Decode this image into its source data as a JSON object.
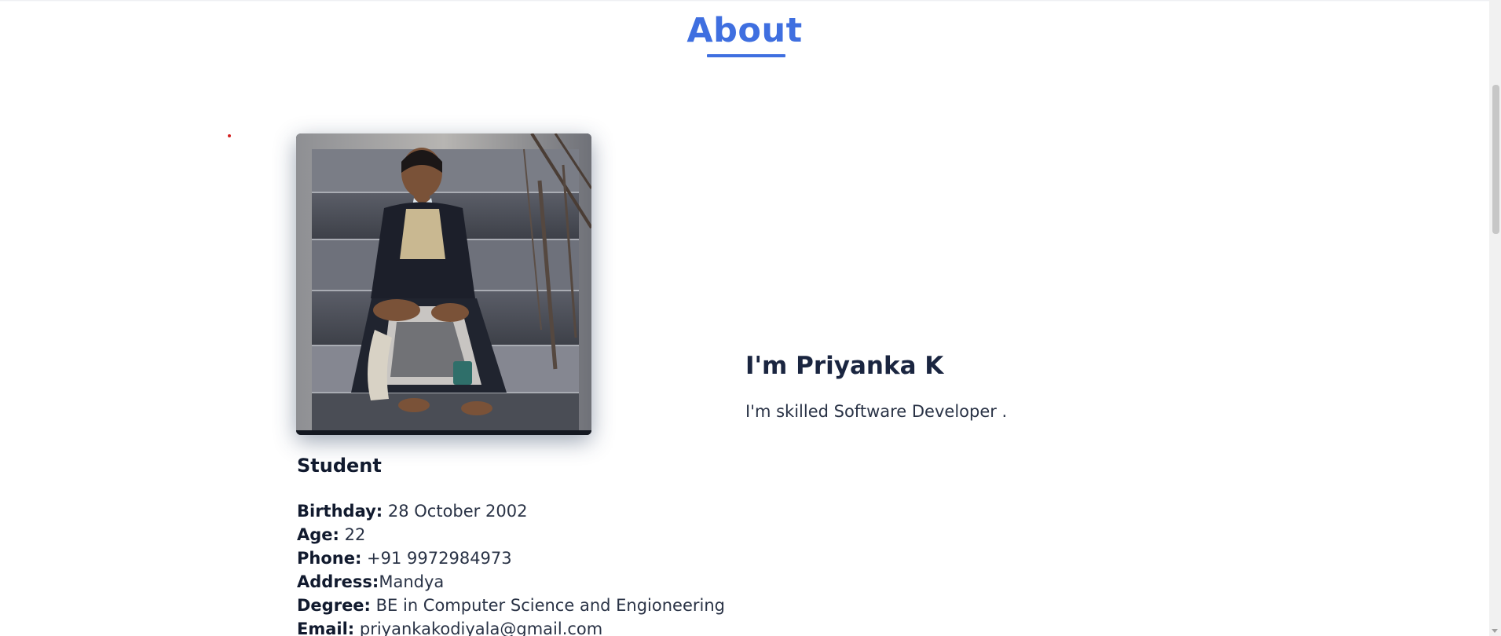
{
  "section": {
    "title": "About"
  },
  "profile": {
    "photo_alt": "profile-photo",
    "role": "Student",
    "details": [
      {
        "label": "Birthday:",
        "value": " 28 October 2002"
      },
      {
        "label": "Age:",
        "value": " 22"
      },
      {
        "label": "Phone:",
        "value": " +91 9972984973"
      },
      {
        "label": "Address:",
        "value": "Mandya"
      },
      {
        "label": "Degree:",
        "value": " BE in Computer Science and Engioneering"
      },
      {
        "label": "Email:",
        "value": " priyankakodiyala@gmail.com"
      }
    ]
  },
  "intro": {
    "heading": "I'm Priyanka K",
    "text": "I'm skilled Software Developer ."
  },
  "colors": {
    "accent": "#3f6fe0",
    "heading": "#1a2540",
    "text": "#2a3346"
  }
}
